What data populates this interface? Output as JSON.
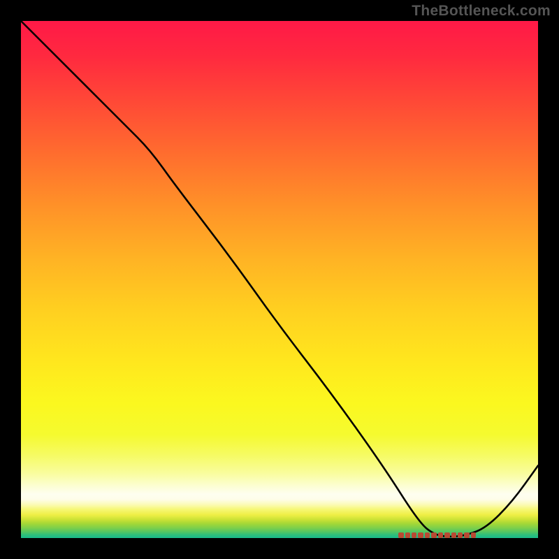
{
  "watermark": "TheBottleneck.com",
  "chart_data": {
    "type": "line",
    "title": "",
    "xlabel": "",
    "ylabel": "",
    "xlim": [
      0,
      100
    ],
    "ylim": [
      0,
      100
    ],
    "grid": false,
    "legend": false,
    "series": [
      {
        "name": "curve",
        "x": [
          0,
          10,
          20,
          25,
          30,
          40,
          50,
          60,
          70,
          77,
          80,
          83,
          86,
          90,
          95,
          100
        ],
        "y": [
          100,
          90,
          80,
          75,
          68,
          55,
          41,
          28,
          14,
          3,
          0.6,
          0.2,
          0.5,
          2,
          7,
          14
        ]
      }
    ],
    "markers": {
      "name": "baseline-marker",
      "x_start": 73,
      "x_end": 88,
      "y": 0.6,
      "count": 12,
      "color": "#b84a33"
    },
    "background_gradient": {
      "top": "#ff1947",
      "mid": "#ffe71e",
      "valley_light": "#fefef0",
      "bottom": "#19bb8b"
    }
  }
}
